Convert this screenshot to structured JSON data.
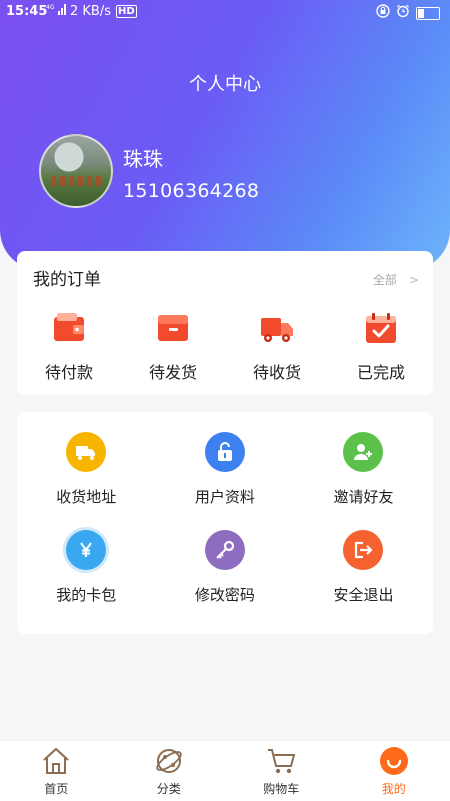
{
  "status_bar": {
    "time": "15:45",
    "network": "4G",
    "speed": "2 KB/s",
    "hd": "HD"
  },
  "header": {
    "title": "个人中心"
  },
  "user": {
    "name": "珠珠",
    "phone": "15106364268"
  },
  "orders": {
    "title": "我的订单",
    "all_label": "全部",
    "chevron": ">",
    "items": [
      {
        "label": "待付款",
        "icon": "wallet-icon",
        "color": "#f24a2c"
      },
      {
        "label": "待发货",
        "icon": "box-icon",
        "color": "#f24a2c"
      },
      {
        "label": "待收货",
        "icon": "truck-icon",
        "color": "#f24a2c"
      },
      {
        "label": "已完成",
        "icon": "check-calendar-icon",
        "color": "#f24a2c"
      }
    ]
  },
  "services": {
    "items": [
      {
        "label": "收货地址",
        "icon": "truck-icon",
        "color": "#f7b500"
      },
      {
        "label": "用户资料",
        "icon": "lock-icon",
        "color": "#3d80f0"
      },
      {
        "label": "邀请好友",
        "icon": "add-user-icon",
        "color": "#5cc14a"
      },
      {
        "label": "我的卡包",
        "icon": "yen-icon",
        "color": "#3aa8f0"
      },
      {
        "label": "修改密码",
        "icon": "key-icon",
        "color": "#8e6cc0"
      },
      {
        "label": "安全退出",
        "icon": "logout-icon",
        "color": "#f5612f"
      }
    ]
  },
  "tabbar": {
    "items": [
      {
        "label": "首页",
        "icon": "home-icon"
      },
      {
        "label": "分类",
        "icon": "category-icon"
      },
      {
        "label": "购物车",
        "icon": "cart-icon"
      },
      {
        "label": "我的",
        "icon": "profile-icon",
        "active": true
      }
    ],
    "active_color": "#ff6a1a"
  }
}
